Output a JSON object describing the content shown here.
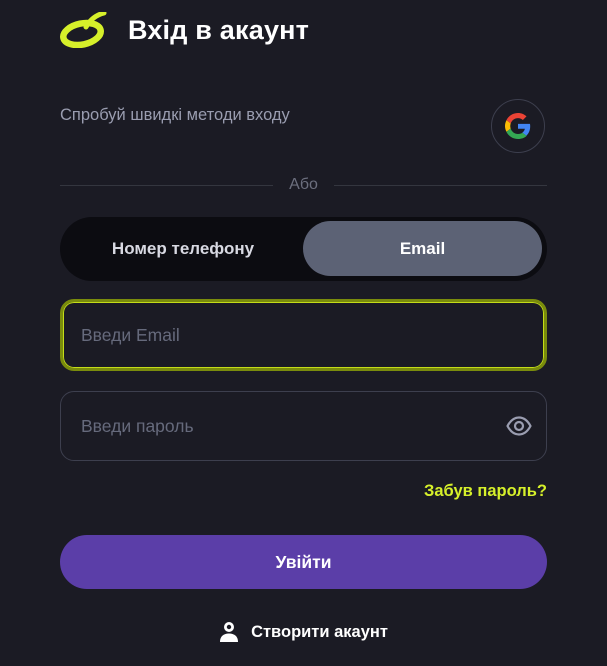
{
  "header": {
    "title": "Вхід в акаунт",
    "brand_color": "#d6f02a"
  },
  "quick_login": {
    "text": "Спробуй швидкі методи входу",
    "google_icon": "google-icon"
  },
  "divider": {
    "label": "Або"
  },
  "tabs": [
    {
      "label": "Номер телефону",
      "active": false
    },
    {
      "label": "Email",
      "active": true
    }
  ],
  "email_field": {
    "value": "",
    "placeholder": "Введи Email"
  },
  "password_field": {
    "value": "",
    "placeholder": "Введи пароль",
    "toggle_icon": "eye-icon"
  },
  "forgot_password": "Забув пароль?",
  "login_button": "Увійти",
  "create_account": {
    "label": "Створити акаунт",
    "icon": "user-icon"
  },
  "colors": {
    "background": "#1b1b24",
    "accent": "#d6f02a",
    "primary_button": "#5b3ea8",
    "active_tab": "#5c6275"
  }
}
